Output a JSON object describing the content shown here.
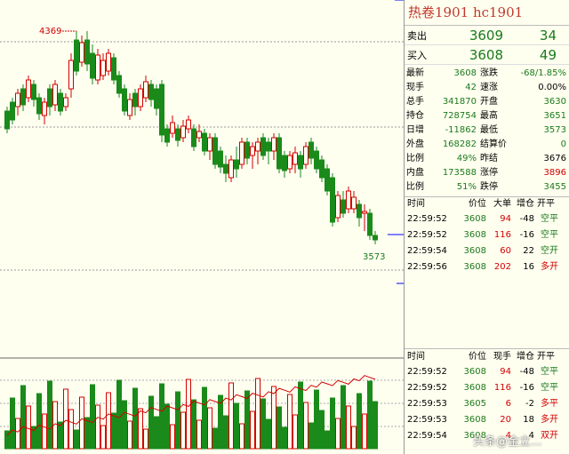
{
  "title": "热卷1901  hc1901",
  "quote": {
    "sell": {
      "label": "卖出",
      "price": "3609",
      "volume": "34"
    },
    "buy": {
      "label": "买入",
      "price": "3608",
      "volume": "49"
    }
  },
  "stats": [
    {
      "l1": "最新",
      "v1": "3608",
      "c1": "green",
      "l2": "涨跌",
      "v2": "-68/1.85%",
      "c2": "green"
    },
    {
      "l1": "现手",
      "v1": "42",
      "c1": "green",
      "l2": "速涨",
      "v2": "0.00%",
      "c2": "blk"
    },
    {
      "l1": "总手",
      "v1": "341870",
      "c1": "green",
      "l2": "开盘",
      "v2": "3630",
      "c2": "green"
    },
    {
      "l1": "持仓",
      "v1": "728754",
      "c1": "green",
      "l2": "最高",
      "v2": "3651",
      "c2": "green"
    },
    {
      "l1": "日增",
      "v1": "-11862",
      "c1": "green",
      "l2": "最低",
      "v2": "3573",
      "c2": "green"
    },
    {
      "l1": "外盘",
      "v1": "168282",
      "c1": "green",
      "l2": "结算价",
      "v2": "0",
      "c2": "green"
    },
    {
      "l1": "比例",
      "v1": "49%",
      "c1": "green",
      "l2": "昨结",
      "v2": "3676",
      "c2": "blk"
    },
    {
      "l1": "内盘",
      "v1": "173588",
      "c1": "green",
      "l2": "涨停",
      "v2": "3896",
      "c2": "red"
    },
    {
      "l1": "比例",
      "v1": "51%",
      "c1": "green",
      "l2": "跌停",
      "v2": "3455",
      "c2": "green"
    }
  ],
  "ticks_top": {
    "headers": [
      "时间",
      "价位",
      "大单",
      "增仓",
      "开平"
    ],
    "rows": [
      {
        "time": "22:59:52",
        "price": "3608",
        "vol": "94",
        "chg": "-48",
        "type": "空平"
      },
      {
        "time": "22:59:52",
        "price": "3608",
        "vol": "116",
        "chg": "-16",
        "type": "空平"
      },
      {
        "time": "22:59:54",
        "price": "3608",
        "vol": "60",
        "chg": "22",
        "type": "空开"
      },
      {
        "time": "22:59:56",
        "price": "3608",
        "vol": "202",
        "chg": "16",
        "type": "多开"
      }
    ]
  },
  "ticks_bottom": {
    "headers": [
      "时间",
      "价位",
      "现手",
      "增仓",
      "开平"
    ],
    "rows": [
      {
        "time": "22:59:52",
        "price": "3608",
        "vol": "94",
        "chg": "-48",
        "type": "空平"
      },
      {
        "time": "22:59:52",
        "price": "3608",
        "vol": "116",
        "chg": "-16",
        "type": "空平"
      },
      {
        "time": "22:59:53",
        "price": "3605",
        "vol": "6",
        "chg": "-2",
        "type": "多平"
      },
      {
        "time": "22:59:53",
        "price": "3608",
        "vol": "20",
        "chg": "18",
        "type": "多开"
      },
      {
        "time": "22:59:54",
        "price": "3608",
        "vol": "4",
        "chg": "4",
        "type": "双开"
      }
    ]
  },
  "chart_labels": {
    "high": "4369",
    "low": "3573"
  },
  "watermark": "头条@金立...",
  "colors": {
    "up": "#d10000",
    "down": "#1a8a1a",
    "bg": "#fffff0"
  }
}
